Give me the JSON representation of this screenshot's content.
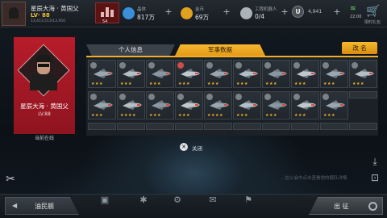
{
  "player": {
    "name": "星辰大海 · 黄国父",
    "level": "LV· 88",
    "exp": "13,413,513/13,950"
  },
  "rank": {
    "value": "54"
  },
  "resources": [
    {
      "icon": "fuel-icon",
      "label": "晶体",
      "value": "817万",
      "color": "#3b8fd8"
    },
    {
      "icon": "gold-icon",
      "label": "金币",
      "value": "69万",
      "color": "#e0a020"
    },
    {
      "icon": "engineer-icon",
      "label": "工程机器人",
      "value": "0/4",
      "color": "#aab2ba"
    }
  ],
  "u_currency": {
    "symbol": "U",
    "value": "4,941"
  },
  "time": "22:00",
  "shop": {
    "label": "商城",
    "sub": "限时礼包"
  },
  "profile": {
    "name": "星辰大海 · 黄国父",
    "level": "LV.88",
    "status": "当前在线"
  },
  "tabs": [
    {
      "label": "个人信息",
      "active": false
    },
    {
      "label": "军事数据",
      "active": true
    }
  ],
  "rename_label": "改 名",
  "cards_row1": [
    {
      "stars": "★★★",
      "badge": "#7a8288"
    },
    {
      "stars": "★★★",
      "badge": "#7a8288"
    },
    {
      "stars": "★★★",
      "badge": "#7a8288"
    },
    {
      "stars": "★★★",
      "badge": "#d04a4a"
    },
    {
      "stars": "★★★",
      "badge": "#7a8288"
    },
    {
      "stars": "★★★",
      "badge": "#7a8288"
    },
    {
      "stars": "★★★",
      "badge": "#7a8288"
    },
    {
      "stars": "★★★",
      "badge": "#7a8288"
    },
    {
      "stars": "★★★",
      "badge": "#7a8288"
    },
    {
      "stars": "★★★",
      "badge": "#7a8288"
    }
  ],
  "cards_row2": [
    {
      "stars": "★★★",
      "badge": "#7a8288"
    },
    {
      "stars": "★★★★",
      "badge": "#7a8288"
    },
    {
      "stars": "★★★",
      "badge": "#7a8288"
    },
    {
      "stars": "★★★",
      "badge": "#7a8288"
    },
    {
      "stars": "★★★★",
      "badge": "#7a8288"
    },
    {
      "stars": "★★★",
      "badge": "#7a8288"
    },
    {
      "stars": "★★★",
      "badge": "#7a8288"
    },
    {
      "stars": "★★★",
      "badge": "#7a8288"
    },
    {
      "stars": "★★★",
      "badge": "#7a8288"
    }
  ],
  "close_label": "关闭",
  "hint_text": "…在公会中点击查看他的舰队详情",
  "bottom": {
    "left_label": "油民舰",
    "right_label": "出 征"
  },
  "nav_items": [
    {
      "icon": "fleet-icon",
      "label": ""
    },
    {
      "icon": "alliance-icon",
      "label": ""
    },
    {
      "icon": "build-icon",
      "label": ""
    },
    {
      "icon": "mail-icon",
      "label": ""
    },
    {
      "icon": "mission-icon",
      "label": ""
    }
  ]
}
